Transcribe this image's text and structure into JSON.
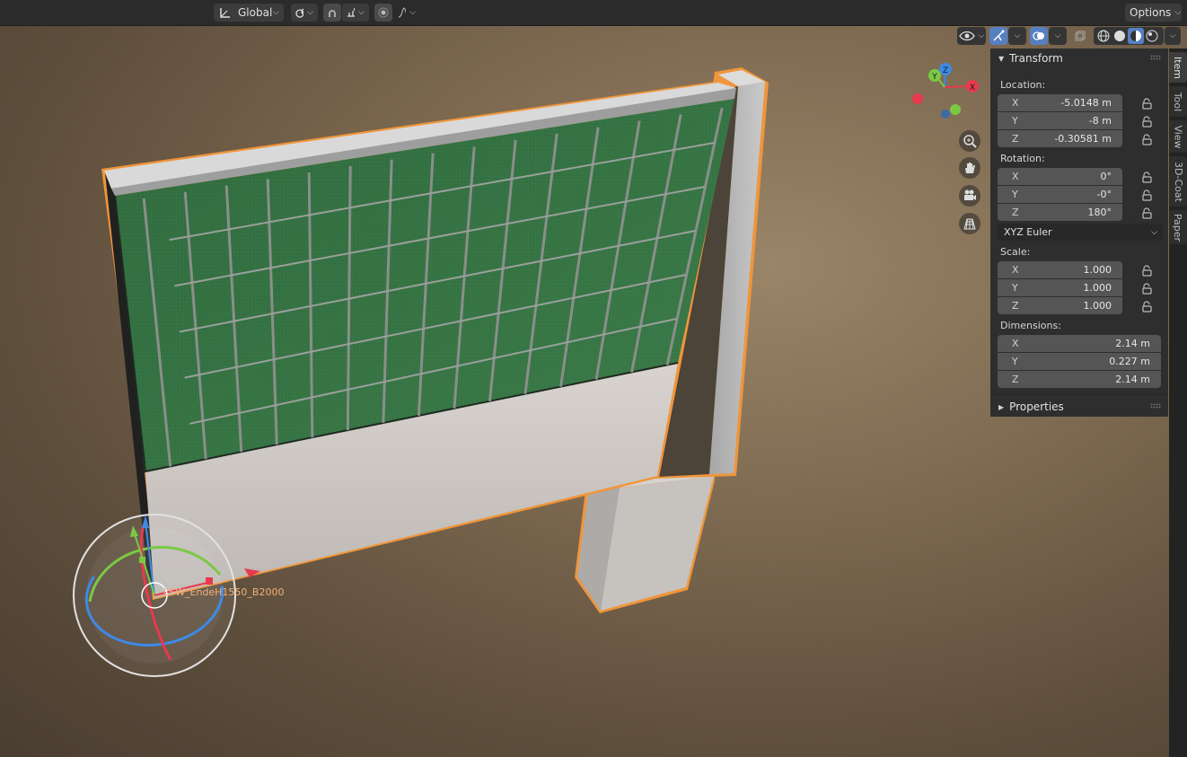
{
  "header": {
    "orientation": "Global",
    "options": "Options"
  },
  "viewport": {
    "object_label": "LSW_EndeH1550_B2000",
    "gizmo_axes": [
      "X",
      "Y",
      "Z"
    ]
  },
  "sidebar": {
    "tabs": [
      "Item",
      "Tool",
      "View",
      "3D-Coat",
      "Paper"
    ],
    "active_tab": "Item",
    "transform": {
      "title": "Transform",
      "location": {
        "label": "Location:",
        "x": {
          "axis": "X",
          "value": "-5.0148 m"
        },
        "y": {
          "axis": "Y",
          "value": "-8 m"
        },
        "z": {
          "axis": "Z",
          "value": "-0.30581 m"
        }
      },
      "rotation": {
        "label": "Rotation:",
        "x": {
          "axis": "X",
          "value": "0°"
        },
        "y": {
          "axis": "Y",
          "value": "-0°"
        },
        "z": {
          "axis": "Z",
          "value": "180°"
        },
        "mode": "XYZ Euler"
      },
      "scale": {
        "label": "Scale:",
        "x": {
          "axis": "X",
          "value": "1.000"
        },
        "y": {
          "axis": "Y",
          "value": "1.000"
        },
        "z": {
          "axis": "Z",
          "value": "1.000"
        }
      },
      "dimensions": {
        "label": "Dimensions:",
        "x": {
          "axis": "X",
          "value": "2.14 m"
        },
        "y": {
          "axis": "Y",
          "value": "0.227 m"
        },
        "z": {
          "axis": "Z",
          "value": "2.14 m"
        }
      }
    },
    "properties": {
      "title": "Properties"
    }
  },
  "colors": {
    "accent": "#5680c2",
    "selection_outline": "#f0953a",
    "axis_x": "#e8394d",
    "axis_y": "#7ac943",
    "axis_z": "#3d8ae6"
  }
}
